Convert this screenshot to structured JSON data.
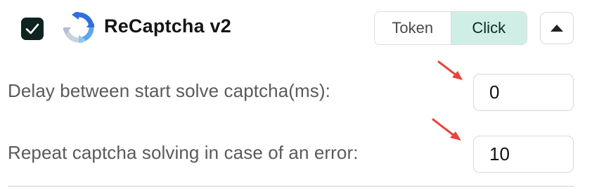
{
  "header": {
    "enabled": true,
    "logo_icon": "recaptcha-logo-icon",
    "title": "ReCaptcha v2",
    "mode_options": [
      "Token",
      "Click"
    ],
    "selected_mode": "Click",
    "collapse_icon": "chevron-up-icon"
  },
  "settings": [
    {
      "label": "Delay between start solve captcha(ms):",
      "value": "0"
    },
    {
      "label": "Repeat captcha solving in case of an error:",
      "value": "10"
    }
  ],
  "colors": {
    "checkbox_bg": "#0e2420",
    "active_segment_bg": "#cfeee6",
    "annotation_arrow": "#e8443a"
  }
}
